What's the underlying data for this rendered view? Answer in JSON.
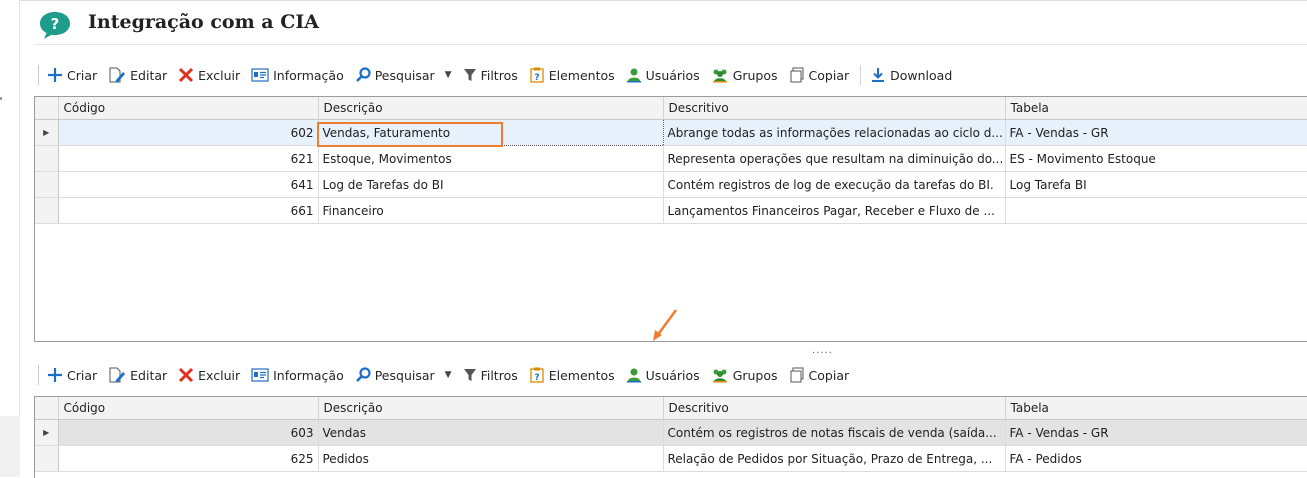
{
  "page": {
    "title": "Integração com a CIA"
  },
  "toolbar_top": {
    "items": [
      {
        "label": "Criar",
        "icon": "plus-icon"
      },
      {
        "label": "Editar",
        "icon": "edit-icon"
      },
      {
        "label": "Excluir",
        "icon": "delete-x-icon"
      },
      {
        "label": "Informação",
        "icon": "info-card-icon"
      },
      {
        "label": "Pesquisar",
        "icon": "search-icon"
      },
      {
        "label": "Filtros",
        "icon": "filter-icon"
      },
      {
        "label": "Elementos",
        "icon": "elements-icon"
      },
      {
        "label": "Usuários",
        "icon": "user-icon"
      },
      {
        "label": "Grupos",
        "icon": "group-icon"
      },
      {
        "label": "Copiar",
        "icon": "copy-icon"
      },
      {
        "label": "Download",
        "icon": "download-icon"
      }
    ]
  },
  "toolbar_bottom": {
    "items": [
      {
        "label": "Criar",
        "icon": "plus-icon"
      },
      {
        "label": "Editar",
        "icon": "edit-icon"
      },
      {
        "label": "Excluir",
        "icon": "delete-x-icon"
      },
      {
        "label": "Informação",
        "icon": "info-card-icon"
      },
      {
        "label": "Pesquisar",
        "icon": "search-icon"
      },
      {
        "label": "Filtros",
        "icon": "filter-icon"
      },
      {
        "label": "Elementos",
        "icon": "elements-icon"
      },
      {
        "label": "Usuários",
        "icon": "user-icon"
      },
      {
        "label": "Grupos",
        "icon": "group-icon"
      },
      {
        "label": "Copiar",
        "icon": "copy-icon"
      }
    ]
  },
  "grid_top": {
    "columns": [
      "Código",
      "Descrição",
      "Descritivo",
      "Tabela"
    ],
    "rows": [
      {
        "codigo": "602",
        "descricao": "Vendas, Faturamento",
        "descritivo": "Abrange todas as informações relacionadas ao ciclo d...",
        "tabela": "FA - Vendas - GR"
      },
      {
        "codigo": "621",
        "descricao": "Estoque, Movimentos",
        "descritivo": "Representa operações que resultam na diminuição do...",
        "tabela": "ES - Movimento Estoque"
      },
      {
        "codigo": "641",
        "descricao": "Log de Tarefas do BI",
        "descritivo": "Contém registros de log de execução da tarefas do BI.",
        "tabela": "Log Tarefa BI"
      },
      {
        "codigo": "661",
        "descricao": "Financeiro",
        "descritivo": "Lançamentos Financeiros Pagar, Receber e Fluxo de ...",
        "tabela": ""
      }
    ]
  },
  "grid_bottom": {
    "columns": [
      "Código",
      "Descrição",
      "Descritivo",
      "Tabela"
    ],
    "rows": [
      {
        "codigo": "603",
        "descricao": "Vendas",
        "descritivo": "Contém os registros de notas fiscais de venda (saída...",
        "tabela": "FA - Vendas - GR"
      },
      {
        "codigo": "625",
        "descricao": "Pedidos",
        "descritivo": "Relação de Pedidos por Situação, Prazo de Entrega, ...",
        "tabela": "FA - Pedidos"
      }
    ]
  },
  "splitter": {
    "label": "....."
  },
  "colors": {
    "highlight": "#ef7d2e",
    "accent": "#1e6fc7",
    "selected_row": "#e6f1fb"
  }
}
